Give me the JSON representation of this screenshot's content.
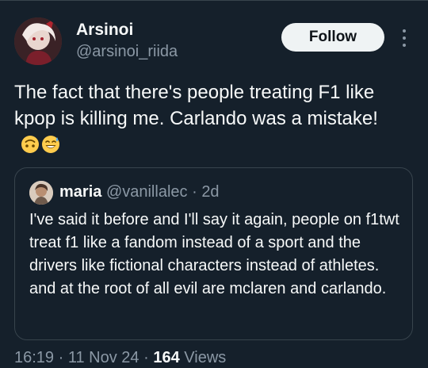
{
  "author": {
    "display_name": "Arsinoi",
    "handle": "@arsinoi_riida"
  },
  "follow_button": {
    "label": "Follow"
  },
  "tweet": {
    "text": "The fact that there's people treating F1 like kpop is killing me. Carlando was a mistake!",
    "emojis": [
      "upside-down-face-emoji",
      "grinning-sweat-emoji"
    ]
  },
  "quote": {
    "name": "maria",
    "handle": "@vanillalec",
    "separator": "·",
    "time": "2d",
    "text": "I've said it before and I'll say it again, people on f1twt treat f1 like a fandom instead of a sport and the drivers like fictional characters instead of athletes. and at the root of all evil are mclaren and carlando."
  },
  "meta": {
    "time": "16:19",
    "separator": "·",
    "date": "11 Nov 24",
    "views_count": "164",
    "views_label": "Views"
  },
  "colors": {
    "background": "#15202b",
    "text_primary": "#f7f9f9",
    "text_secondary": "#8b98a5",
    "border": "#38444d",
    "follow_bg": "#eff3f4"
  }
}
